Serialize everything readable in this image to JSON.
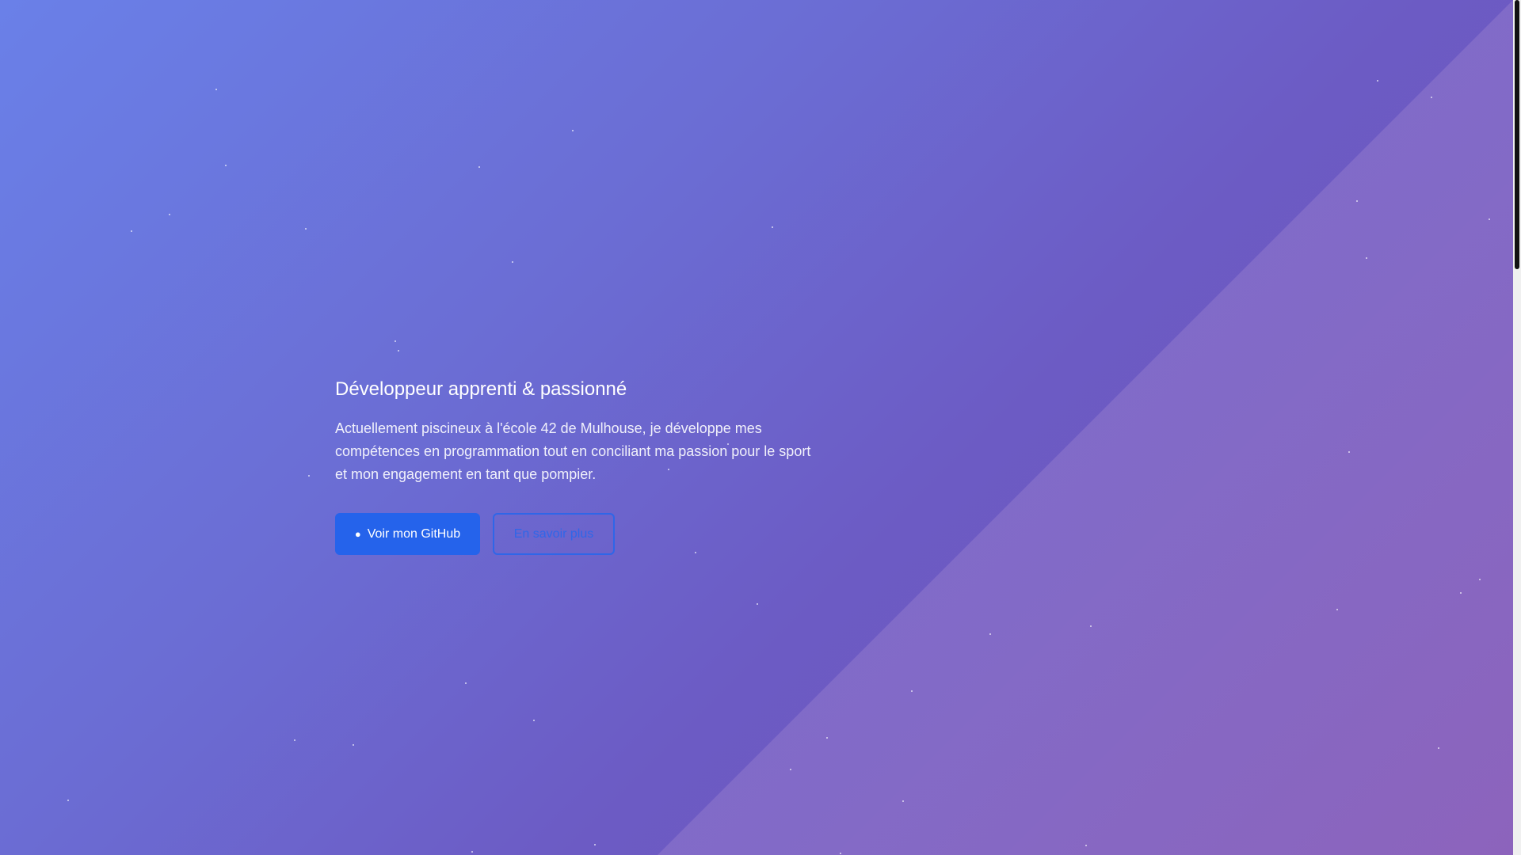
{
  "hero": {
    "title": "Développeur apprenti & passionné",
    "description": "Actuellement piscineux à l'école 42 de Mulhouse, je développe mes compétences en programmation tout en conciliant ma passion pour le sport et mon engagement en tant que pompier."
  },
  "actions": {
    "github_icon": "github-icon",
    "github_label": "Voir mon GitHub",
    "more_label": "En savoir plus"
  },
  "colors": {
    "primary_button": "#2563eb",
    "outline_button": "#2f66e8",
    "background_start": "#6a80e8",
    "background_end": "#7356b6"
  }
}
